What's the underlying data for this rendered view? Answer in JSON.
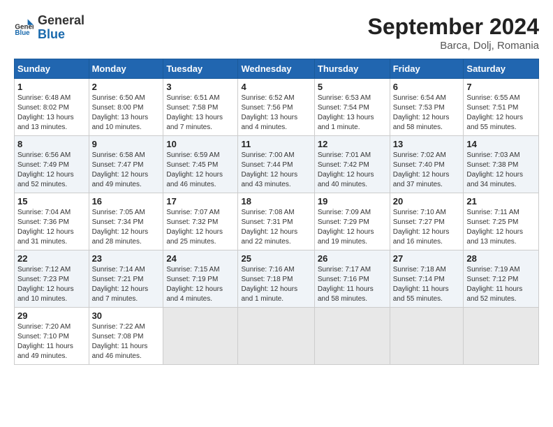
{
  "logo": {
    "text_general": "General",
    "text_blue": "Blue"
  },
  "title": "September 2024",
  "location": "Barca, Dolj, Romania",
  "days_of_week": [
    "Sunday",
    "Monday",
    "Tuesday",
    "Wednesday",
    "Thursday",
    "Friday",
    "Saturday"
  ],
  "weeks": [
    [
      {
        "day": "1",
        "info": "Sunrise: 6:48 AM\nSunset: 8:02 PM\nDaylight: 13 hours\nand 13 minutes."
      },
      {
        "day": "2",
        "info": "Sunrise: 6:50 AM\nSunset: 8:00 PM\nDaylight: 13 hours\nand 10 minutes."
      },
      {
        "day": "3",
        "info": "Sunrise: 6:51 AM\nSunset: 7:58 PM\nDaylight: 13 hours\nand 7 minutes."
      },
      {
        "day": "4",
        "info": "Sunrise: 6:52 AM\nSunset: 7:56 PM\nDaylight: 13 hours\nand 4 minutes."
      },
      {
        "day": "5",
        "info": "Sunrise: 6:53 AM\nSunset: 7:54 PM\nDaylight: 13 hours\nand 1 minute."
      },
      {
        "day": "6",
        "info": "Sunrise: 6:54 AM\nSunset: 7:53 PM\nDaylight: 12 hours\nand 58 minutes."
      },
      {
        "day": "7",
        "info": "Sunrise: 6:55 AM\nSunset: 7:51 PM\nDaylight: 12 hours\nand 55 minutes."
      }
    ],
    [
      {
        "day": "8",
        "info": "Sunrise: 6:56 AM\nSunset: 7:49 PM\nDaylight: 12 hours\nand 52 minutes."
      },
      {
        "day": "9",
        "info": "Sunrise: 6:58 AM\nSunset: 7:47 PM\nDaylight: 12 hours\nand 49 minutes."
      },
      {
        "day": "10",
        "info": "Sunrise: 6:59 AM\nSunset: 7:45 PM\nDaylight: 12 hours\nand 46 minutes."
      },
      {
        "day": "11",
        "info": "Sunrise: 7:00 AM\nSunset: 7:44 PM\nDaylight: 12 hours\nand 43 minutes."
      },
      {
        "day": "12",
        "info": "Sunrise: 7:01 AM\nSunset: 7:42 PM\nDaylight: 12 hours\nand 40 minutes."
      },
      {
        "day": "13",
        "info": "Sunrise: 7:02 AM\nSunset: 7:40 PM\nDaylight: 12 hours\nand 37 minutes."
      },
      {
        "day": "14",
        "info": "Sunrise: 7:03 AM\nSunset: 7:38 PM\nDaylight: 12 hours\nand 34 minutes."
      }
    ],
    [
      {
        "day": "15",
        "info": "Sunrise: 7:04 AM\nSunset: 7:36 PM\nDaylight: 12 hours\nand 31 minutes."
      },
      {
        "day": "16",
        "info": "Sunrise: 7:05 AM\nSunset: 7:34 PM\nDaylight: 12 hours\nand 28 minutes."
      },
      {
        "day": "17",
        "info": "Sunrise: 7:07 AM\nSunset: 7:32 PM\nDaylight: 12 hours\nand 25 minutes."
      },
      {
        "day": "18",
        "info": "Sunrise: 7:08 AM\nSunset: 7:31 PM\nDaylight: 12 hours\nand 22 minutes."
      },
      {
        "day": "19",
        "info": "Sunrise: 7:09 AM\nSunset: 7:29 PM\nDaylight: 12 hours\nand 19 minutes."
      },
      {
        "day": "20",
        "info": "Sunrise: 7:10 AM\nSunset: 7:27 PM\nDaylight: 12 hours\nand 16 minutes."
      },
      {
        "day": "21",
        "info": "Sunrise: 7:11 AM\nSunset: 7:25 PM\nDaylight: 12 hours\nand 13 minutes."
      }
    ],
    [
      {
        "day": "22",
        "info": "Sunrise: 7:12 AM\nSunset: 7:23 PM\nDaylight: 12 hours\nand 10 minutes."
      },
      {
        "day": "23",
        "info": "Sunrise: 7:14 AM\nSunset: 7:21 PM\nDaylight: 12 hours\nand 7 minutes."
      },
      {
        "day": "24",
        "info": "Sunrise: 7:15 AM\nSunset: 7:19 PM\nDaylight: 12 hours\nand 4 minutes."
      },
      {
        "day": "25",
        "info": "Sunrise: 7:16 AM\nSunset: 7:18 PM\nDaylight: 12 hours\nand 1 minute."
      },
      {
        "day": "26",
        "info": "Sunrise: 7:17 AM\nSunset: 7:16 PM\nDaylight: 11 hours\nand 58 minutes."
      },
      {
        "day": "27",
        "info": "Sunrise: 7:18 AM\nSunset: 7:14 PM\nDaylight: 11 hours\nand 55 minutes."
      },
      {
        "day": "28",
        "info": "Sunrise: 7:19 AM\nSunset: 7:12 PM\nDaylight: 11 hours\nand 52 minutes."
      }
    ],
    [
      {
        "day": "29",
        "info": "Sunrise: 7:20 AM\nSunset: 7:10 PM\nDaylight: 11 hours\nand 49 minutes."
      },
      {
        "day": "30",
        "info": "Sunrise: 7:22 AM\nSunset: 7:08 PM\nDaylight: 11 hours\nand 46 minutes."
      },
      {
        "day": "",
        "info": ""
      },
      {
        "day": "",
        "info": ""
      },
      {
        "day": "",
        "info": ""
      },
      {
        "day": "",
        "info": ""
      },
      {
        "day": "",
        "info": ""
      }
    ]
  ]
}
